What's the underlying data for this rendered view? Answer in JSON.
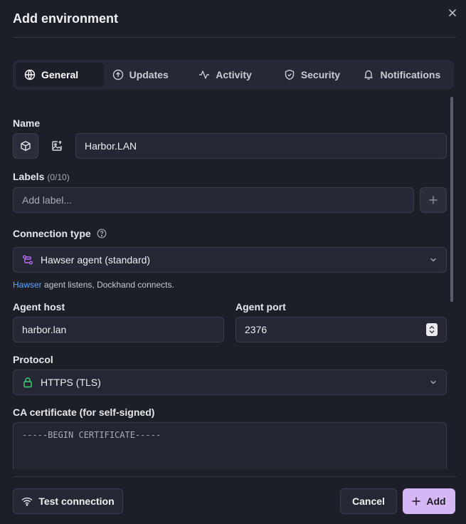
{
  "dialog": {
    "title": "Add environment"
  },
  "tabs": [
    {
      "label": "General",
      "icon": "globe-icon",
      "active": true
    },
    {
      "label": "Updates",
      "icon": "upload-circle-icon",
      "active": false
    },
    {
      "label": "Activity",
      "icon": "activity-icon",
      "active": false
    },
    {
      "label": "Security",
      "icon": "shield-icon",
      "active": false
    },
    {
      "label": "Notifications",
      "icon": "bell-icon",
      "active": false
    }
  ],
  "name": {
    "label": "Name",
    "value": "Harbor.LAN"
  },
  "labels": {
    "label": "Labels",
    "count": "(0/10)",
    "placeholder": "Add label..."
  },
  "connection_type": {
    "label": "Connection type",
    "value": "Hawser agent (standard)",
    "help_link": "Hawser",
    "help_text": " agent listens, Dockhand connects."
  },
  "agent_host": {
    "label": "Agent host",
    "value": "harbor.lan"
  },
  "agent_port": {
    "label": "Agent port",
    "value": "2376"
  },
  "protocol": {
    "label": "Protocol",
    "value": "HTTPS (TLS)"
  },
  "ca_cert": {
    "label": "CA certificate (for self-signed)",
    "placeholder": "-----BEGIN CERTIFICATE-----"
  },
  "footer": {
    "test_label": "Test connection",
    "cancel_label": "Cancel",
    "add_label": "Add"
  },
  "colors": {
    "accent": "#d6b7f5",
    "link": "#5aa5ff",
    "protocol_lock": "#3ecf6e",
    "agent_icon": "#b56cf0"
  }
}
